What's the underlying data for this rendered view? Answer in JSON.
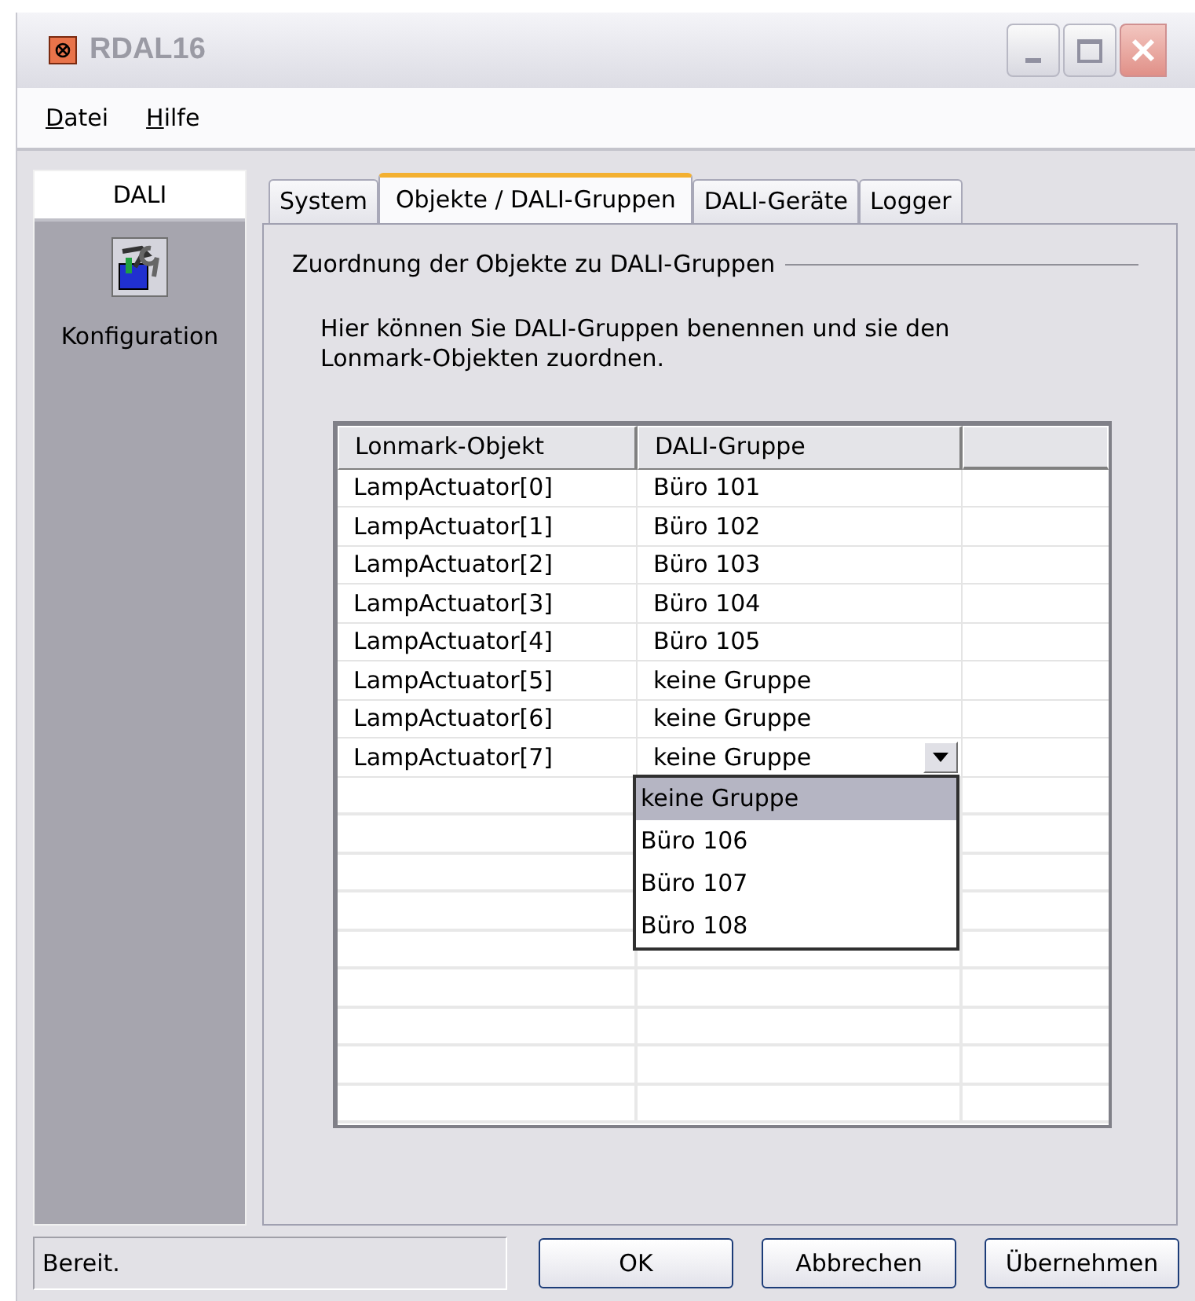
{
  "window": {
    "title": "RDAL16"
  },
  "menu": [
    "Datei",
    "Hilfe"
  ],
  "sidebar": {
    "header": "DALI",
    "items": [
      {
        "label": "Konfiguration",
        "selected": true
      }
    ]
  },
  "tabs": [
    {
      "label": "System",
      "selected": false
    },
    {
      "label": "Objekte / DALI-Gruppen",
      "selected": true
    },
    {
      "label": "DALI-Geräte",
      "selected": false
    },
    {
      "label": "Logger",
      "selected": false
    }
  ],
  "group_title": "Zuordnung der Objekte zu DALI-Gruppen",
  "description": "Hier können Sie DALI-Gruppen benennen und sie den Lonmark-Objekten zuordnen.",
  "table": {
    "columns": [
      "Lonmark-Objekt",
      "DALI-Gruppe"
    ],
    "rows": [
      {
        "object": "LampActuator[0]",
        "group": "Büro 101",
        "editing": false
      },
      {
        "object": "LampActuator[1]",
        "group": "Büro 102",
        "editing": false
      },
      {
        "object": "LampActuator[2]",
        "group": "Büro 103",
        "editing": false
      },
      {
        "object": "LampActuator[3]",
        "group": "Büro 104",
        "editing": false
      },
      {
        "object": "LampActuator[4]",
        "group": "Büro 105",
        "editing": false
      },
      {
        "object": "LampActuator[5]",
        "group": "keine Gruppe",
        "editing": false
      },
      {
        "object": "LampActuator[6]",
        "group": "keine Gruppe",
        "editing": false
      },
      {
        "object": "LampActuator[7]",
        "group": "keine Gruppe",
        "editing": true
      }
    ]
  },
  "dropdown": {
    "options": [
      {
        "label": "keine Gruppe",
        "selected": true
      },
      {
        "label": "Büro 106",
        "selected": false
      },
      {
        "label": "Büro 107",
        "selected": false
      },
      {
        "label": "Büro 108",
        "selected": false
      }
    ]
  },
  "status_bar": "Bereit.",
  "buttons": [
    "OK",
    "Abbrechen",
    "Übernehmen"
  ]
}
